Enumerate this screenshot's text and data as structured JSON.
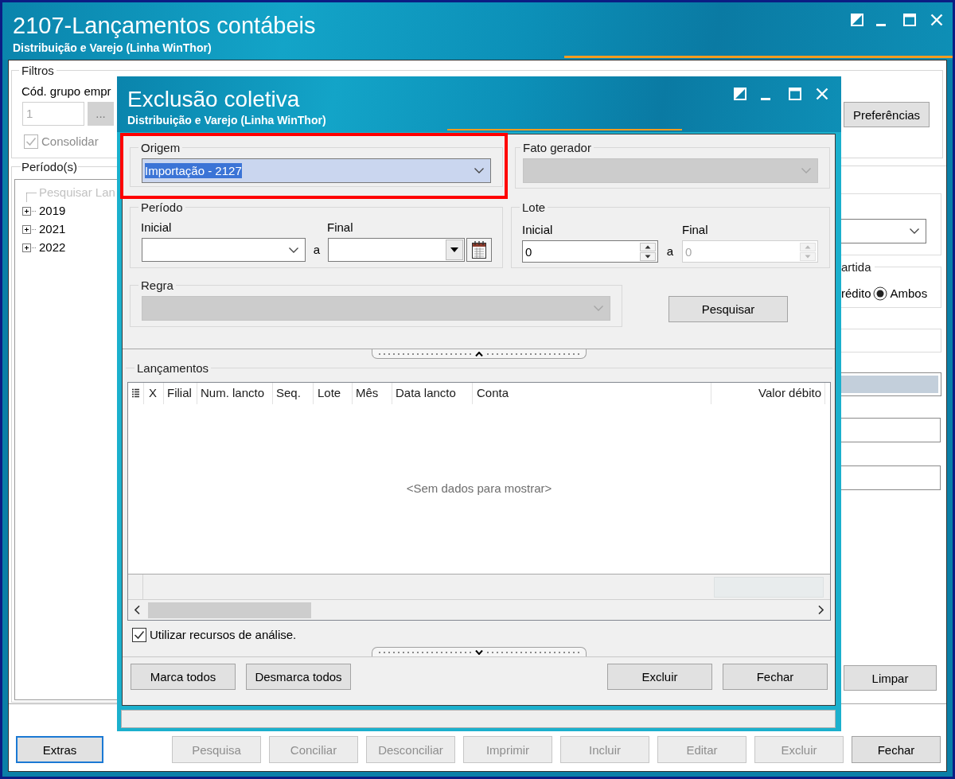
{
  "main_window": {
    "title": "2107-Lançamentos contábeis",
    "subtitle": "Distribuição e Varejo (Linha WinThor)",
    "filters": {
      "label": "Filtros",
      "group_code_label": "Cód. grupo empr",
      "group_code_value": "1",
      "group_code_disabled": true,
      "lookup_button": "...",
      "consolidate": {
        "label": "Consolidar",
        "checked": true,
        "disabled": true
      }
    },
    "periods": {
      "label": "Período(s)",
      "tree": [
        {
          "label": "Pesquisar Lan",
          "kind": "search",
          "disabled": true
        },
        {
          "label": "2019",
          "kind": "year",
          "disabled": false,
          "expanded": false
        },
        {
          "label": "2021",
          "kind": "year",
          "disabled": false,
          "expanded": false
        },
        {
          "label": "2022",
          "kind": "year",
          "disabled": false,
          "expanded": false
        }
      ]
    },
    "preferences_button": "Preferências",
    "partida": {
      "label": "artida",
      "clipped_option": "rédito",
      "option": {
        "label": "Ambos",
        "selected": true
      }
    },
    "clear_button": "Limpar",
    "footer_buttons": [
      {
        "label": "Extras",
        "disabled": false,
        "focused": true
      },
      {
        "label": "Pesquisa",
        "disabled": true,
        "focused": false
      },
      {
        "label": "Conciliar",
        "disabled": true,
        "focused": false
      },
      {
        "label": "Desconciliar",
        "disabled": true,
        "focused": false
      },
      {
        "label": "Imprimir",
        "disabled": true,
        "focused": false
      },
      {
        "label": "Incluir",
        "disabled": true,
        "focused": false
      },
      {
        "label": "Editar",
        "disabled": true,
        "focused": false
      },
      {
        "label": "Excluir",
        "disabled": true,
        "focused": false
      },
      {
        "label": "Fechar",
        "disabled": false,
        "focused": false
      }
    ]
  },
  "dialog": {
    "title": "Exclusão coletiva",
    "subtitle": "Distribuição e Varejo (Linha WinThor)",
    "origem": {
      "label": "Origem",
      "value": "Importação - 2127",
      "text_selected": true,
      "highlighted": true
    },
    "fato_gerador": {
      "label": "Fato gerador",
      "disabled": true
    },
    "periodo": {
      "label": "Período",
      "initial_label": "Inicial",
      "separator": "a",
      "final_label": "Final"
    },
    "lote": {
      "label": "Lote",
      "initial_label": "Inicial",
      "initial_value": "0",
      "separator": "a",
      "final_label": "Final",
      "final_value": "0",
      "final_disabled": true
    },
    "regra": {
      "label": "Regra",
      "disabled": true
    },
    "search_button": "Pesquisar",
    "lancamentos": {
      "label": "Lançamentos",
      "columns": [
        "X",
        "Filial",
        "Num. lancto",
        "Seq.",
        "Lote",
        "Mês",
        "Data lancto",
        "Conta",
        "Valor débito"
      ],
      "empty_text": "<Sem dados para mostrar>"
    },
    "analysis": {
      "label": "Utilizar recursos de análise.",
      "checked": true
    },
    "left_buttons": [
      "Marca todos",
      "Desmarca todos"
    ],
    "right_buttons": [
      "Excluir",
      "Fechar"
    ]
  }
}
